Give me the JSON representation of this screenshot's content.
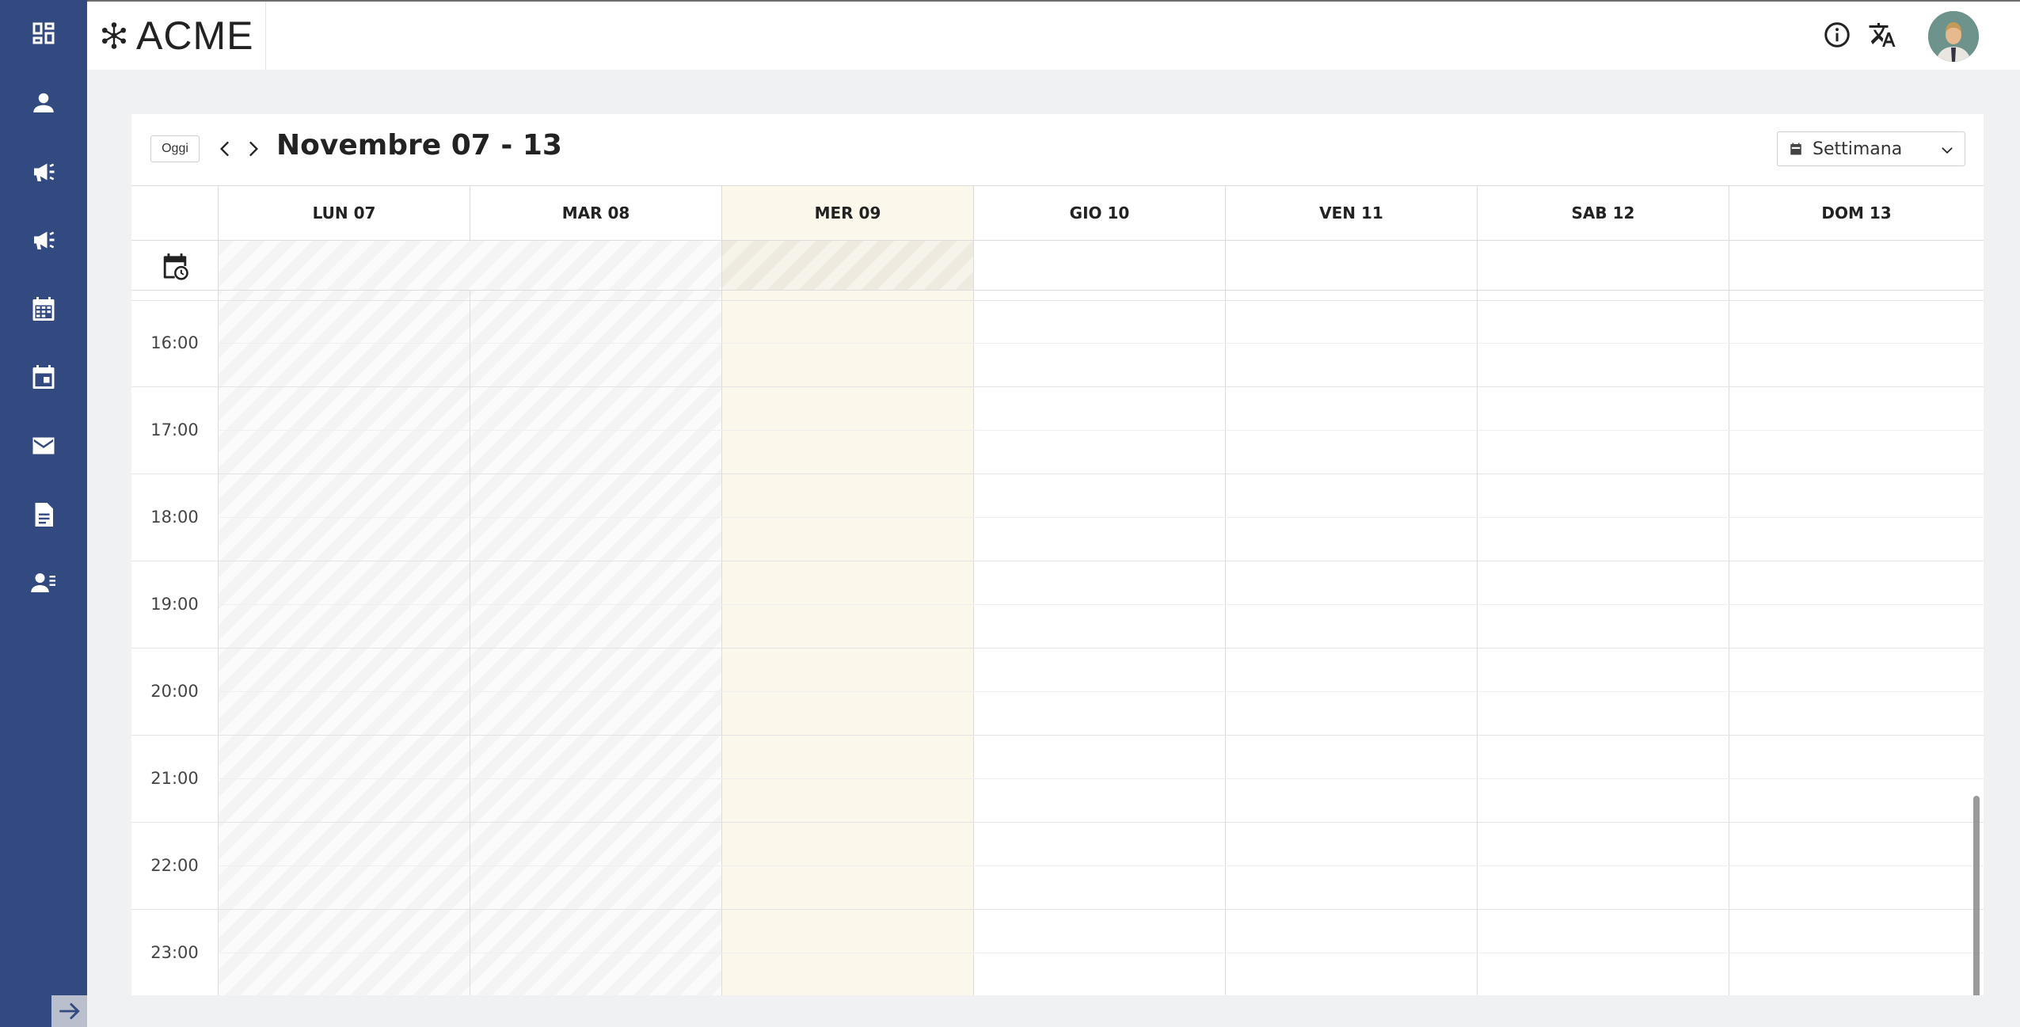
{
  "app": {
    "brand": "ACME"
  },
  "sidebar": {
    "items": [
      {
        "name": "dashboard",
        "icon": "dashboard-icon"
      },
      {
        "name": "users",
        "icon": "person-icon"
      },
      {
        "name": "campaigns",
        "icon": "megaphone-icon"
      },
      {
        "name": "campaigns-alt",
        "icon": "megaphone-icon"
      },
      {
        "name": "calendar",
        "icon": "calendar-grid-icon"
      },
      {
        "name": "event",
        "icon": "calendar-event-icon"
      },
      {
        "name": "mail",
        "icon": "mail-icon"
      },
      {
        "name": "documents",
        "icon": "document-icon"
      },
      {
        "name": "contacts",
        "icon": "contacts-icon"
      }
    ],
    "collapse_icon": "arrow-right-icon"
  },
  "header": {
    "icons": [
      "info-icon",
      "translate-icon"
    ],
    "avatar": "user-avatar"
  },
  "calendar": {
    "today_label": "Oggi",
    "range_title": "Novembre 07 - 13",
    "view_label": "Settimana",
    "days": [
      "LUN 07",
      "MAR 08",
      "MER 09",
      "GIO 10",
      "VEN 11",
      "SAB 12",
      "DOM 13"
    ],
    "today_index": 2,
    "past_indices": [
      0,
      1
    ],
    "hours": [
      "16:00",
      "17:00",
      "18:00",
      "19:00",
      "20:00",
      "21:00",
      "22:00",
      "23:00"
    ]
  },
  "colors": {
    "sidebar": "#324a80",
    "today": "#fbf7ea",
    "background": "#f0f1f3"
  }
}
